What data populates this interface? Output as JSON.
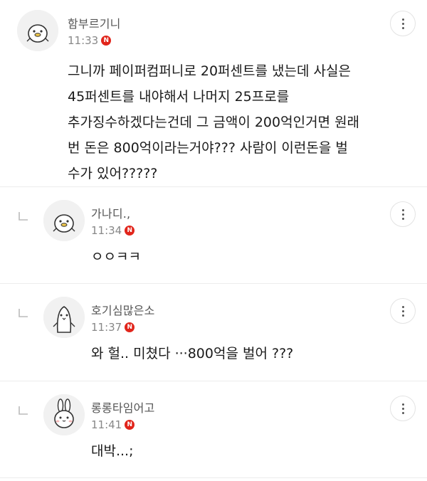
{
  "comments": [
    {
      "nickname": "함부르기니",
      "time": "11:33",
      "badge": "N",
      "lines": [
        "그니까 페이퍼컴퍼니로 20퍼센트를 냈는데 사실은",
        "45퍼센트를 내야해서 나머지 25프로를",
        "추가징수하겠다는건데 그 금액이 200억인거면 원래",
        "번 돈은 800억이라는거야??? 사람이 이런돈을 벌",
        "수가 있어?????"
      ]
    },
    {
      "nickname": "가나디.,",
      "time": "11:34",
      "badge": "N",
      "lines": [
        "ㅇㅇㅋㅋ"
      ]
    },
    {
      "nickname": "호기심많은소",
      "time": "11:37",
      "badge": "N",
      "lines": [
        "와 헐.. 미쳤다 ···800억을 벌어 ???"
      ]
    },
    {
      "nickname": "롱롱타임어고",
      "time": "11:41",
      "badge": "N",
      "lines": [
        "대박...;"
      ]
    }
  ],
  "colors": {
    "badge": "#e1251b",
    "divider": "#ececec",
    "nickname": "#555555",
    "time": "#888888"
  },
  "icons": {
    "more": "more-vertical-icon",
    "reply": "reply-arrow-icon"
  }
}
